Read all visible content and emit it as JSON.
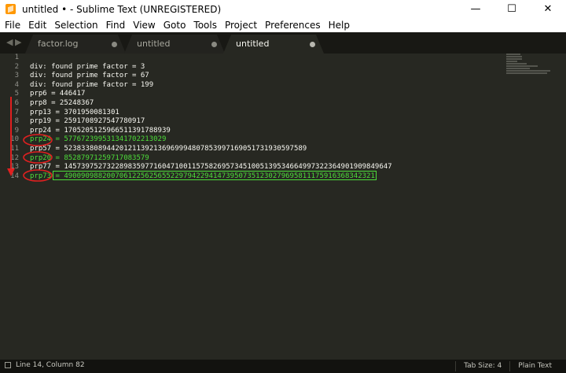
{
  "window": {
    "title": "untitled • - Sublime Text (UNREGISTERED)",
    "minimize": "—",
    "maximize": "☐",
    "close": "✕"
  },
  "menu": [
    "File",
    "Edit",
    "Selection",
    "Find",
    "View",
    "Goto",
    "Tools",
    "Project",
    "Preferences",
    "Help"
  ],
  "tabs": [
    {
      "label": "factor.log",
      "active": false
    },
    {
      "label": "untitled",
      "active": false
    },
    {
      "label": "untitled",
      "active": true
    }
  ],
  "editor": {
    "line_numbers": [
      "1",
      "2",
      "3",
      "4",
      "5",
      "6",
      "7",
      "8",
      "9",
      "10",
      "11",
      "12",
      "13",
      "14"
    ],
    "lines": [
      "",
      "div: found prime factor = 3",
      "div: found prime factor = 67",
      "div: found prime factor = 199",
      "prp6 = 446417",
      "prp8 = 25248367",
      "prp13 = 3701950081301",
      "prp19 = 2591708927547780917",
      "prp24 = 170520512596651139178893​9",
      "prp24 = 577672399531341702213029",
      "prp57 = 523833808944201211392136969994807853997169051731930597589",
      "prp20 = 85287971259717083579",
      "prp77 = 14573975273228983597716047100115758269573451005139534664997322364901909849647",
      "prp73 = 4900909882007061225625655229794229414739507351230279695811175916368342321"
    ]
  },
  "status": {
    "position": "Line 14, Column 82",
    "tab_size": "Tab Size: 4",
    "syntax": "Plain Text"
  },
  "colors": {
    "background": "#272822",
    "highlight_text": "#4dde3a",
    "annotation": "#e02020"
  }
}
